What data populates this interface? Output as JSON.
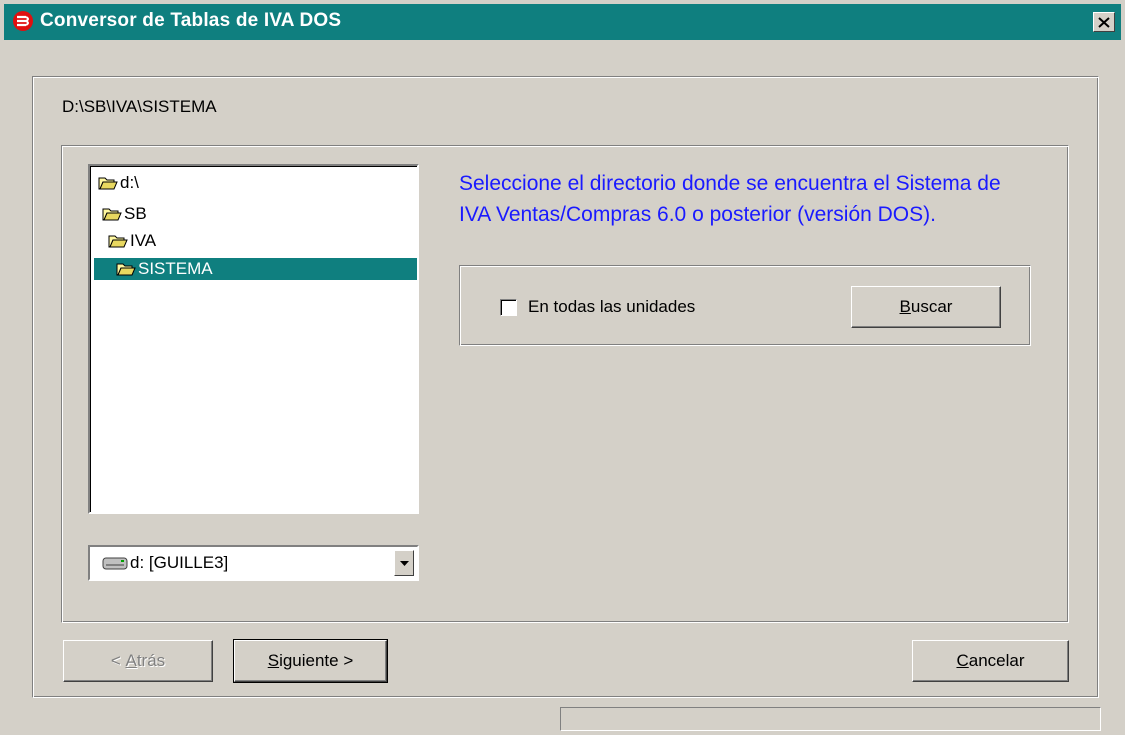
{
  "window": {
    "title": "Conversor de Tablas de IVA DOS",
    "close_label": "×"
  },
  "path": "D:\\SB\\IVA\\SISTEMA",
  "tree": {
    "items": [
      {
        "label": "d:\\",
        "selected": false
      },
      {
        "label": "SB",
        "selected": false
      },
      {
        "label": "IVA",
        "selected": false
      },
      {
        "label": "SISTEMA",
        "selected": true
      }
    ]
  },
  "drive": {
    "value": "d: [GUILLE3]"
  },
  "instructions": "Seleccione el directorio donde se encuentra el Sistema de IVA Ventas/Compras 6.0 o posterior (versión DOS).",
  "search": {
    "checkbox_label": "En todas las unidades",
    "checked": false,
    "button_mnemonic": "B",
    "button_rest": "uscar"
  },
  "nav": {
    "back_prefix": "< ",
    "back_mnemonic": "A",
    "back_rest": "trás",
    "next_mnemonic": "S",
    "next_rest": "iguiente >",
    "cancel_mnemonic": "C",
    "cancel_rest": "ancelar"
  },
  "colors": {
    "titlebar": "#0f7f7f",
    "selection": "#0f7f7f",
    "instruction_text": "#1a1aff",
    "face": "#d4d0c8"
  }
}
